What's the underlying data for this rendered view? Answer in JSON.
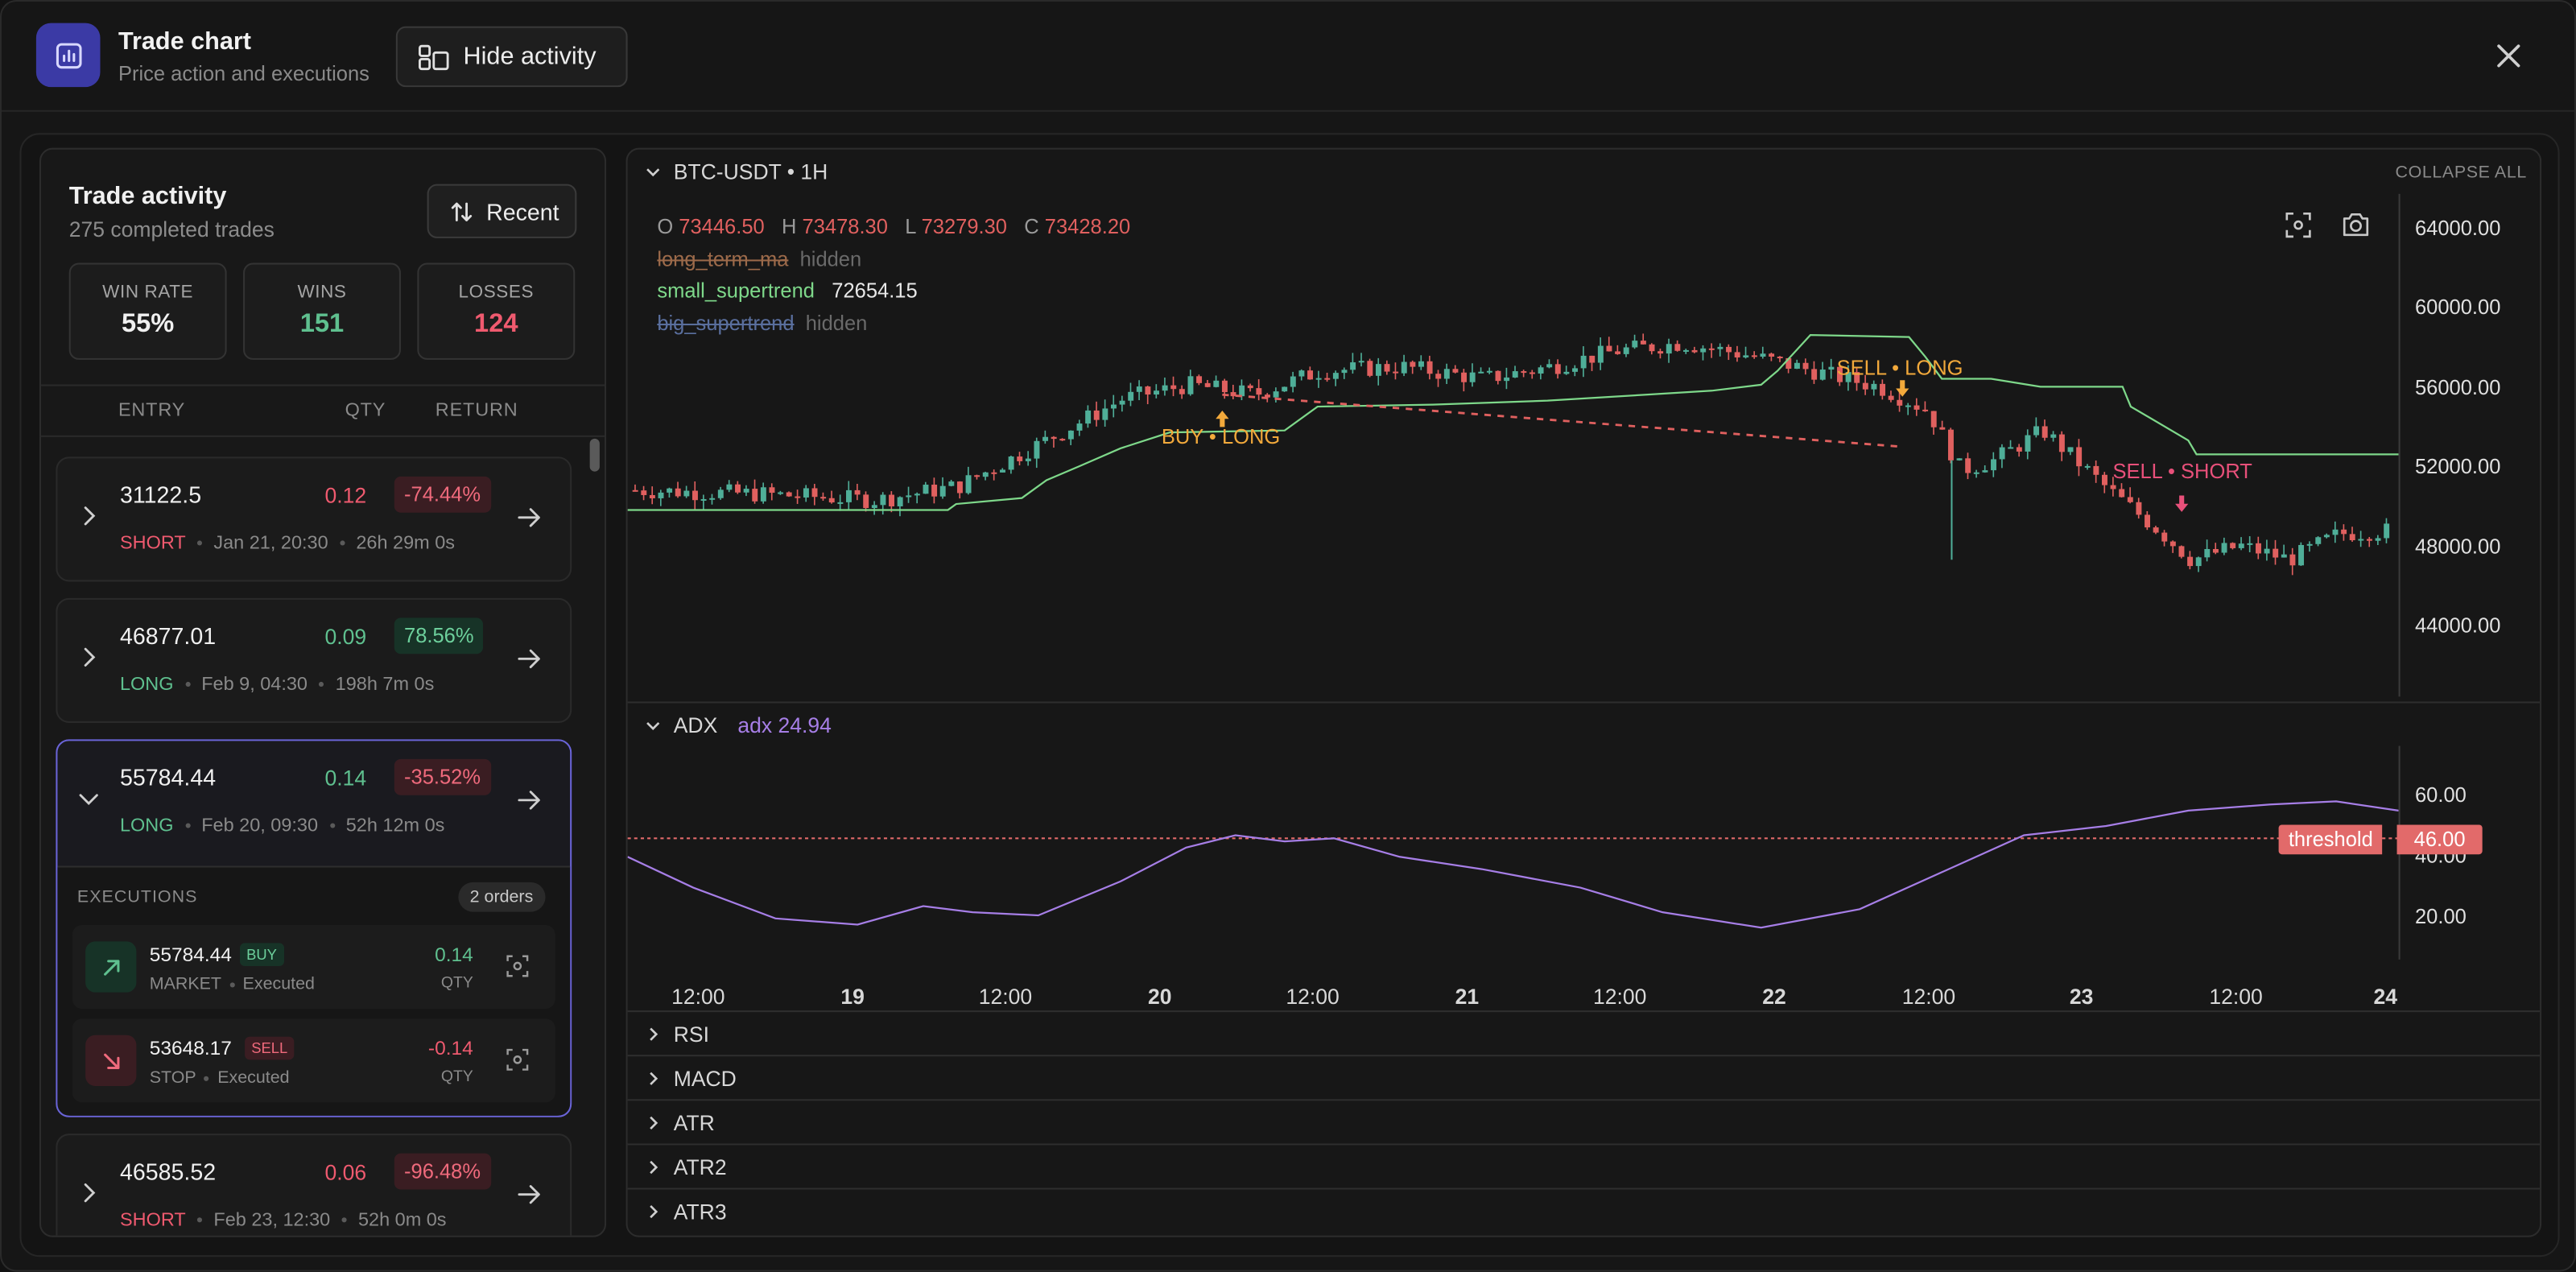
{
  "header": {
    "title": "Trade chart",
    "subtitle": "Price action and executions",
    "hide_activity": "Hide activity"
  },
  "activity": {
    "title": "Trade activity",
    "subtitle": "275 completed trades",
    "recent_button": "Recent",
    "stats": [
      {
        "label": "WIN RATE",
        "value": "55%",
        "color": "#f0f0f0"
      },
      {
        "label": "WINS",
        "value": "151",
        "color": "#5fc08f"
      },
      {
        "label": "LOSSES",
        "value": "124",
        "color": "#ef5a6f"
      }
    ],
    "columns": {
      "entry": "ENTRY",
      "qty": "QTY",
      "return": "RETURN"
    },
    "trades": [
      {
        "entry": "31122.5",
        "qty": "0.12",
        "ret": "-74.44%",
        "side": "SHORT",
        "date": "Jan 21, 20:30",
        "duration": "26h 29m 0s"
      },
      {
        "entry": "46877.01",
        "qty": "0.09",
        "ret": "78.56%",
        "side": "LONG",
        "date": "Feb 9, 04:30",
        "duration": "198h 7m 0s"
      },
      {
        "entry": "55784.44",
        "qty": "0.14",
        "ret": "-35.52%",
        "side": "LONG",
        "date": "Feb 20, 09:30",
        "duration": "52h 12m 0s"
      },
      {
        "entry": "46585.52",
        "qty": "0.06",
        "ret": "-96.48%",
        "side": "SHORT",
        "date": "Feb 23, 12:30",
        "duration": "52h 0m 0s"
      }
    ],
    "executions": {
      "title": "EXECUTIONS",
      "badge": "2 orders",
      "items": [
        {
          "price": "55784.44",
          "tag": "BUY",
          "type": "MARKET",
          "status": "Executed",
          "qty": "0.14",
          "qty_label": "QTY"
        },
        {
          "price": "53648.17",
          "tag": "SELL",
          "type": "STOP",
          "status": "Executed",
          "qty": "-0.14",
          "qty_label": "QTY"
        }
      ]
    }
  },
  "chart": {
    "symbol": "BTC-USDT • 1H",
    "collapse_all": "COLLAPSE ALL",
    "ohlc": {
      "o_label": "O",
      "o": "73446.50",
      "h_label": "H",
      "h": "73478.30",
      "l_label": "L",
      "l": "73279.30",
      "c_label": "C",
      "c": "73428.20"
    },
    "indicators": [
      {
        "name": "long_term_ma",
        "value": "hidden"
      },
      {
        "name": "small_supertrend",
        "value": "72654.15"
      },
      {
        "name": "big_supertrend",
        "value": "hidden"
      }
    ],
    "price_ticks": [
      "64000.00",
      "60000.00",
      "56000.00",
      "52000.00",
      "48000.00",
      "44000.00"
    ],
    "markers": [
      "BUY • LONG",
      "SELL • LONG",
      "SELL • SHORT"
    ],
    "adx": {
      "name": "ADX",
      "value_label": "adx 24.94",
      "ticks": [
        "60.00",
        "40.00",
        "20.00"
      ],
      "threshold_label": "threshold",
      "threshold_value": "46.00"
    },
    "time_ticks": [
      "12:00",
      "19",
      "12:00",
      "20",
      "12:00",
      "21",
      "12:00",
      "22",
      "12:00",
      "23",
      "12:00",
      "24"
    ],
    "collapsed_panes": [
      "RSI",
      "MACD",
      "ATR",
      "ATR2",
      "ATR3"
    ],
    "colors": {
      "up": "#4fae98",
      "down": "#e0605f",
      "supertrend": "#7ed88a",
      "adx": "#a67ee6",
      "buy": "#f2a93b",
      "short": "#e8507a"
    }
  }
}
